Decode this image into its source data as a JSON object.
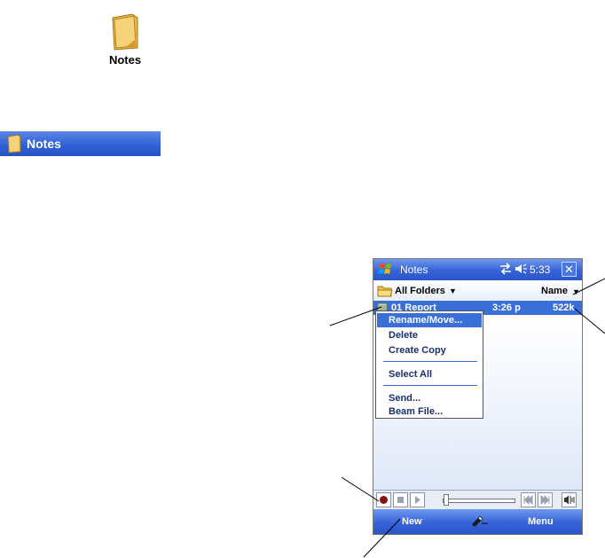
{
  "app_icon": {
    "label": "Notes",
    "icon": "notes-folder-icon"
  },
  "title_strip": {
    "title": "Notes",
    "icon": "notes-folder-icon"
  },
  "device": {
    "nav_bar": {
      "title": "Notes",
      "time": "5:33",
      "close": "✕",
      "icons": [
        "windows-start-icon",
        "sync-icon",
        "volume-icon",
        "close-icon"
      ]
    },
    "folder_bar": {
      "folder": "All Folders",
      "sort": "Name"
    },
    "file": {
      "name": "01 Report",
      "time": "3:26 p",
      "size": "522k"
    },
    "context_menu": {
      "items": [
        {
          "label": "Rename/Move...",
          "selected": true
        },
        {
          "label": "Delete"
        },
        {
          "label": "Create Copy"
        },
        {
          "label": "Select All"
        },
        {
          "label": "Send..."
        },
        {
          "label": "Beam File..."
        }
      ]
    },
    "recorder": {
      "buttons": [
        "record-icon",
        "stop-icon",
        "play-icon",
        "rewind-icon",
        "forward-icon",
        "volume-icon"
      ]
    },
    "soft_bar": {
      "left": "New",
      "right": "Menu"
    }
  },
  "colors": {
    "accent": "#3a6fd8",
    "titlebar": "#2d5fd3"
  }
}
